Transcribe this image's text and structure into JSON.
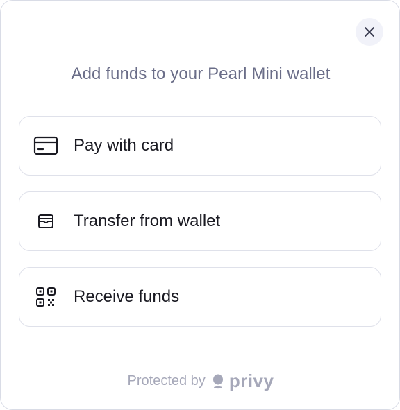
{
  "modal": {
    "title": "Add funds to your Pearl Mini wallet",
    "close_icon": "close-icon"
  },
  "options": [
    {
      "label": "Pay with card",
      "icon": "credit-card-icon"
    },
    {
      "label": "Transfer from wallet",
      "icon": "wallet-icon"
    },
    {
      "label": "Receive funds",
      "icon": "qr-code-icon"
    }
  ],
  "footer": {
    "prefix": "Protected by",
    "brand": "privy",
    "brand_icon": "privy-logo-icon"
  },
  "colors": {
    "title": "#6a6d88",
    "label": "#1a1a22",
    "border": "#dfe1ea",
    "footer": "#a6a8b9",
    "close_bg": "#f1f2f9"
  }
}
